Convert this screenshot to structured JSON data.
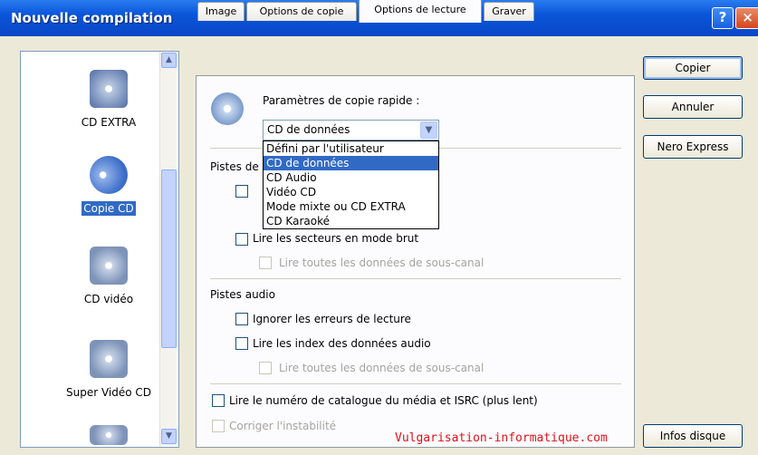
{
  "window": {
    "title": "Nouvelle compilation",
    "help_btn": "?",
    "close_btn": "×"
  },
  "list_items": [
    {
      "label": "CD EXTRA",
      "icon": "cd-extra-icon",
      "selected": false
    },
    {
      "label": "Copie CD",
      "icon": "cd-copy-icon",
      "selected": true
    },
    {
      "label": "CD vidéo",
      "icon": "video-cd-icon",
      "selected": false
    },
    {
      "label": "Super Vidéo CD",
      "icon": "super-video-cd-icon",
      "selected": false
    }
  ],
  "tabs": [
    "Image",
    "Options de copie",
    "Options de lecture",
    "Graver"
  ],
  "active_tab": "Options de lecture",
  "quick_copy": {
    "label": "Paramètres de copie rapide :",
    "selected": "CD de données",
    "options": [
      "Défini par l'utilisateur",
      "CD de données",
      "CD Audio",
      "Vidéo CD",
      "Mode mixte ou CD EXTRA",
      "CD Karaoké"
    ]
  },
  "data_tracks": {
    "heading": "Pistes de",
    "read_raw": "Lire les secteurs en mode brut",
    "read_subchannel": "Lire toutes les données de sous-canal"
  },
  "audio_tracks": {
    "heading": "Pistes audio",
    "ignore_errors": "Ignorer les erreurs de lecture",
    "read_index": "Lire les index des données audio",
    "read_subchannel": "Lire toutes les données de sous-canal"
  },
  "catalog": "Lire le numéro de catalogue du média et ISRC (plus lent)",
  "correct_jitter": "Corriger l'instabilité",
  "buttons": {
    "copy": "Copier",
    "cancel": "Annuler",
    "express": "Nero Express",
    "disc_info": "Infos disque"
  },
  "watermark": "Vulgarisation-informatique.com",
  "colors": {
    "titlebar": "#0a55d9",
    "selection": "#316ac5",
    "watermark": "#e0101a"
  }
}
